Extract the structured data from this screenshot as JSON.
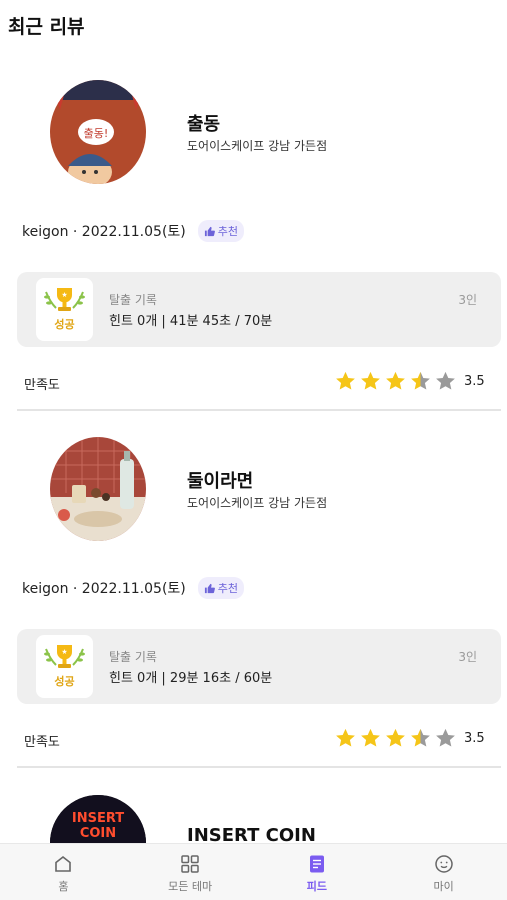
{
  "header": {
    "title": "최근 리뷰"
  },
  "reviews": [
    {
      "theme": "출동",
      "shop": "도어이스케이프 강남 가든점",
      "meta": "keigon · 2022.11.05(토)",
      "badge": "추천",
      "success_label": "성공",
      "record_label": "탈출 기록",
      "record_value": "힌트 0개 | 41분 45초 / 70분",
      "people": "3인",
      "satisfaction_label": "만족도",
      "rating": 3.5,
      "rating_text": "3.5"
    },
    {
      "theme": "둘이라면",
      "shop": "도어이스케이프 강남 가든점",
      "meta": "keigon · 2022.11.05(토)",
      "badge": "추천",
      "success_label": "성공",
      "record_label": "탈출 기록",
      "record_value": "힌트 0개 | 29분 16초 / 60분",
      "people": "3인",
      "satisfaction_label": "만족도",
      "rating": 3.5,
      "rating_text": "3.5"
    },
    {
      "theme": "INSERT COIN",
      "thumb_text": [
        "INSERT",
        "COIN"
      ]
    }
  ],
  "tabs": [
    {
      "label": "홈",
      "icon": "home-icon",
      "active": false
    },
    {
      "label": "모든 테마",
      "icon": "grid-icon",
      "active": false
    },
    {
      "label": "피드",
      "icon": "feed-icon",
      "active": true
    },
    {
      "label": "마이",
      "icon": "smile-icon",
      "active": false
    }
  ],
  "colors": {
    "accent": "#7b5cf0",
    "star": "#f5c518",
    "star_empty": "#9a9a9a",
    "success": "#e0a515"
  }
}
